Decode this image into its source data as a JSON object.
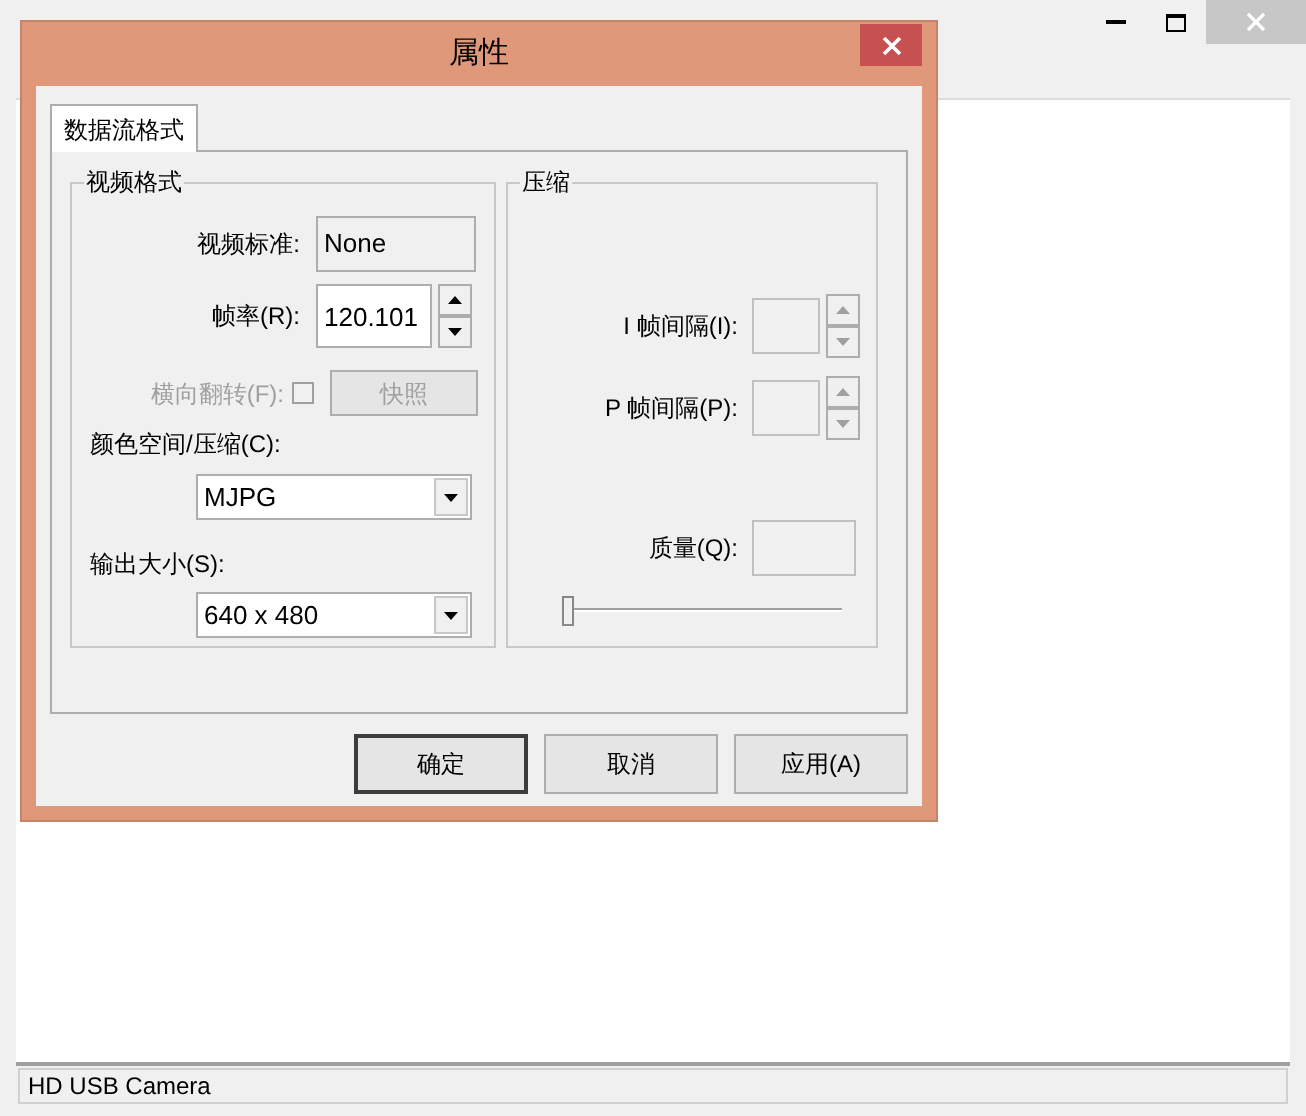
{
  "background_window": {
    "status_bar": "HD USB Camera"
  },
  "dialog": {
    "title": "属性",
    "tabs": [
      {
        "label": "数据流格式",
        "selected": true
      }
    ],
    "video_format": {
      "title": "视频格式",
      "standard": {
        "label": "视频标准:",
        "value": "None"
      },
      "frame_rate": {
        "label": "帧率(R):",
        "value": "120.101"
      },
      "flip": {
        "label": "横向翻转(F):",
        "checked": false,
        "disabled": true
      },
      "snapshot": {
        "label": "快照",
        "disabled": true
      },
      "color_space": {
        "label": "颜色空间/压缩(C):",
        "value": "MJPG"
      },
      "output_size": {
        "label": "输出大小(S):",
        "value": "640 x 480"
      }
    },
    "compression": {
      "title": "压缩",
      "i_frame": {
        "label": "I 帧间隔(I):",
        "disabled": true
      },
      "p_frame": {
        "label": "P 帧间隔(P):",
        "disabled": true
      },
      "quality": {
        "label": "质量(Q):",
        "level": 0
      }
    },
    "buttons": [
      "确定",
      "取消",
      "应用(A)"
    ]
  }
}
